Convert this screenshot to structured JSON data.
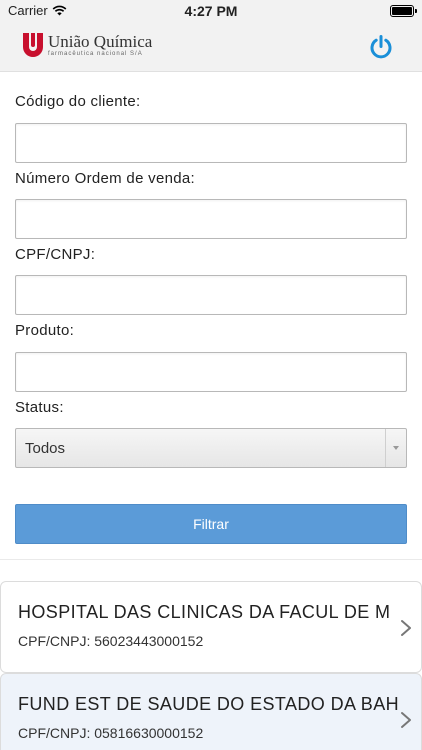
{
  "status_bar": {
    "carrier": "Carrier",
    "time": "4:27 PM"
  },
  "header": {
    "brand_name": "União Química",
    "brand_subtitle": "farmacêutica nacional S/A",
    "brand_color": "#c8102e",
    "power_color": "#1a8fd8"
  },
  "form": {
    "client_code": {
      "label": "Código do cliente:",
      "value": ""
    },
    "order_number": {
      "label": "Número Ordem de venda:",
      "value": ""
    },
    "cpf_cnpj": {
      "label": "CPF/CNPJ:",
      "value": ""
    },
    "product": {
      "label": "Produto:",
      "value": ""
    },
    "status": {
      "label": "Status:",
      "selected": "Todos"
    },
    "filter_label": "Filtrar",
    "filter_color": "#5b9bd8"
  },
  "results": [
    {
      "name": "HOSPITAL DAS CLINICAS DA FACUL DE M",
      "doc": "CPF/CNPJ: 56023443000152"
    },
    {
      "name": "FUND EST DE SAUDE DO ESTADO DA BAHI",
      "doc": "CPF/CNPJ: 05816630000152"
    }
  ]
}
